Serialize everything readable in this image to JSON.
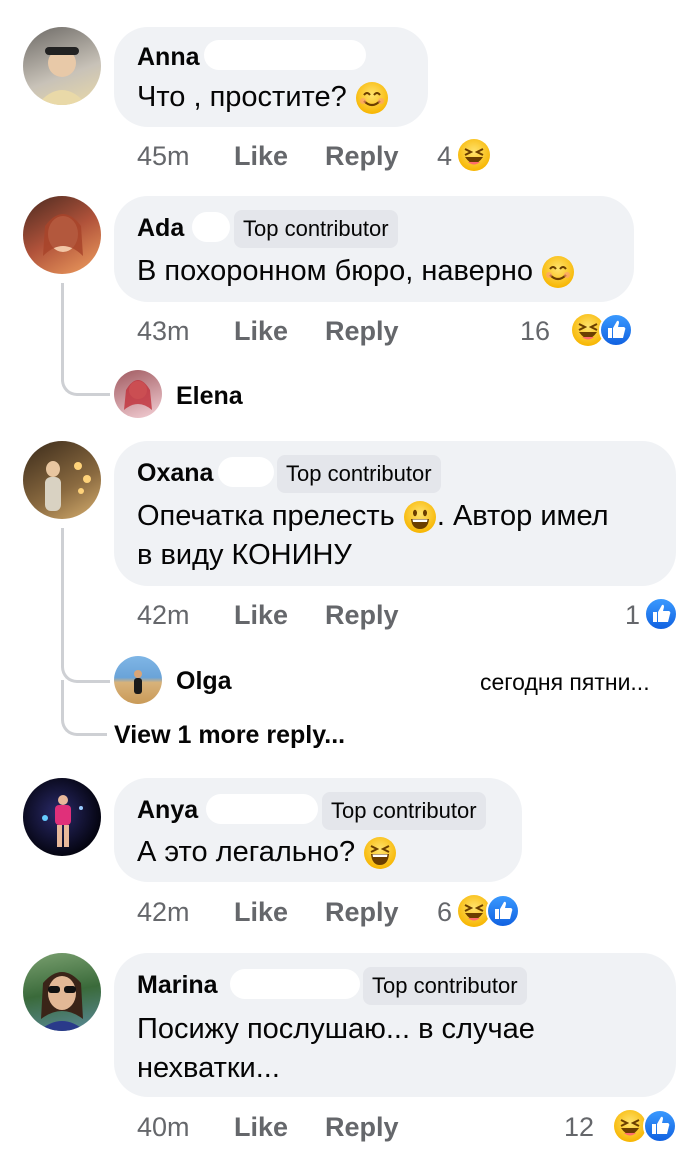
{
  "comments": [
    {
      "name": "Anna",
      "badge": "",
      "lines": [
        "Что , простите?"
      ],
      "time": "45m",
      "like": "Like",
      "reply": "Reply",
      "count": "4"
    },
    {
      "name": "Ada",
      "badge": "Top contributor",
      "lines": [
        "В похоронном бюро, наверно"
      ],
      "time": "43m",
      "like": "Like",
      "reply": "Reply",
      "count": "16",
      "reply_preview": {
        "name": "Elena",
        "snippet": ""
      }
    },
    {
      "name": "Oxana",
      "badge": "Top contributor",
      "lines": [
        "Опечатка прелесть",
        ". Автор имел",
        "в виду КОНИНУ"
      ],
      "time": "42m",
      "like": "Like",
      "reply": "Reply",
      "count": "1",
      "reply_preview": {
        "name": "Olga",
        "snippet": "сегодня пятни..."
      },
      "view_more": "View 1 more reply..."
    },
    {
      "name": "Anya",
      "badge": "Top contributor",
      "lines": [
        "А это легально?"
      ],
      "time": "42m",
      "like": "Like",
      "reply": "Reply",
      "count": "6"
    },
    {
      "name": "Marina",
      "badge": "Top contributor",
      "lines": [
        "Посижу послушаю... в случае",
        "нехватки..."
      ],
      "time": "40m",
      "like": "Like",
      "reply": "Reply",
      "count": "12"
    }
  ],
  "icons": {
    "smile": "smiling-face-emoji-icon",
    "grin": "grinning-face-emoji-icon",
    "laugh": "laughing-face-emoji-icon",
    "like": "like-reaction-icon",
    "haha": "haha-reaction-icon"
  },
  "colors": {
    "like_blue": "#1877f2",
    "emoji_yellow": "#ffcc33",
    "bubble": "#f0f2f5",
    "meta_gray": "#65676b"
  }
}
